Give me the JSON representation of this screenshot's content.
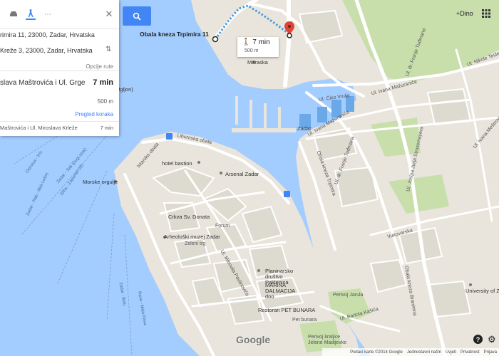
{
  "colors": {
    "water": "#a3ccff",
    "land": "#e9e5dc",
    "park": "#c8dfac",
    "block": "#dddad0",
    "road": "#ffffff",
    "route": "#4a9bde",
    "accent": "#4285f4"
  },
  "panel": {
    "modes": [
      "car-icon",
      "walk-icon",
      "more-icon"
    ],
    "from_value": "rimira 11, 23000, Zadar, Hrvatska",
    "to_value": "Kreže 3, 23000, Zadar, Hrvatska",
    "options_label": "Opcije rute",
    "route_name": "slava Maštrovića i Ul. Grge",
    "route_time": "7 min",
    "route_distance": "500 m",
    "steps_link": "Pregled koraka",
    "alt_route_name": "Maštrovića i Ul. Miroslava Krleže",
    "alt_route_time": "7 min"
  },
  "callout": {
    "time": "7 min",
    "distance": "500 m"
  },
  "header": {
    "user": "+Dino"
  },
  "labels": {
    "origin": "Obala kneza Trpimira 11",
    "maraska": "Maraska",
    "zadar": "Zadar",
    "ugljon": "Ugljon)",
    "liburnska": "Liburnska obala",
    "istarska": "Istarska obala",
    "hotel": "hotel bastion",
    "arsenal": "Arsenal Zadar",
    "morske": "Morske orgulje",
    "donat": "Crkva Sv. Donata",
    "forum": "Forum",
    "arheoloski": "Arheološki muzej Zadar",
    "zeleni": "Zeleni trg",
    "planinarsko": "Planinarsko društvo Paklenica",
    "marina": "MARINA DALMACIJA doo",
    "petbunara": "Restoran PET BUNARA",
    "pet_bunara_sq": "Pet bunara",
    "perivoj": "Perivoj Jarula",
    "perivoj2": "Perivoj kraljice Jelene Madijevke",
    "university": "University of Zadar",
    "vrulje": "Ul. Ćiko Vrulje",
    "mazurana": "Ul. Ivana Mažuranića",
    "mazurana2": "Ul. Ivana Mažuranića",
    "tudman": "Ul. dr. Franje Tuđmana",
    "tudman2": "Ul. dr. Franje Tuđmana",
    "trpimira_road": "Obala kneza Trpimira",
    "branimira": "Obala kneza Branimira",
    "teslle": "Ul. Nikole Tesle",
    "pavlinovica": "Ul. Mihovila Pavlinovića",
    "bartola": "Ul. Bartola Kašića",
    "strossmayera": "Ul. Josipa Jurja Strossmayera",
    "vesnika": "Ul. Ivana Meštrovića",
    "vukovarska": "Vukovarska"
  },
  "ferries": [
    "Zadar - Rab - Mali Lošinj",
    "Ostrvica - Vrh",
    "Silba - Zapuntel (Iž)",
    "Zadar - Sali (Dugi otok)",
    "Zadar - Brbinj (Dugi otok)",
    "Zadar - Bulu",
    "Rava - Mala Rava",
    "Zadar - Brbinj (Iž)"
  ],
  "footer": [
    "Podaci karte ©2014 Google",
    "Jednostavni način",
    "Uvjeti",
    "Privatnost",
    "Prijava"
  ],
  "brand": "Google"
}
